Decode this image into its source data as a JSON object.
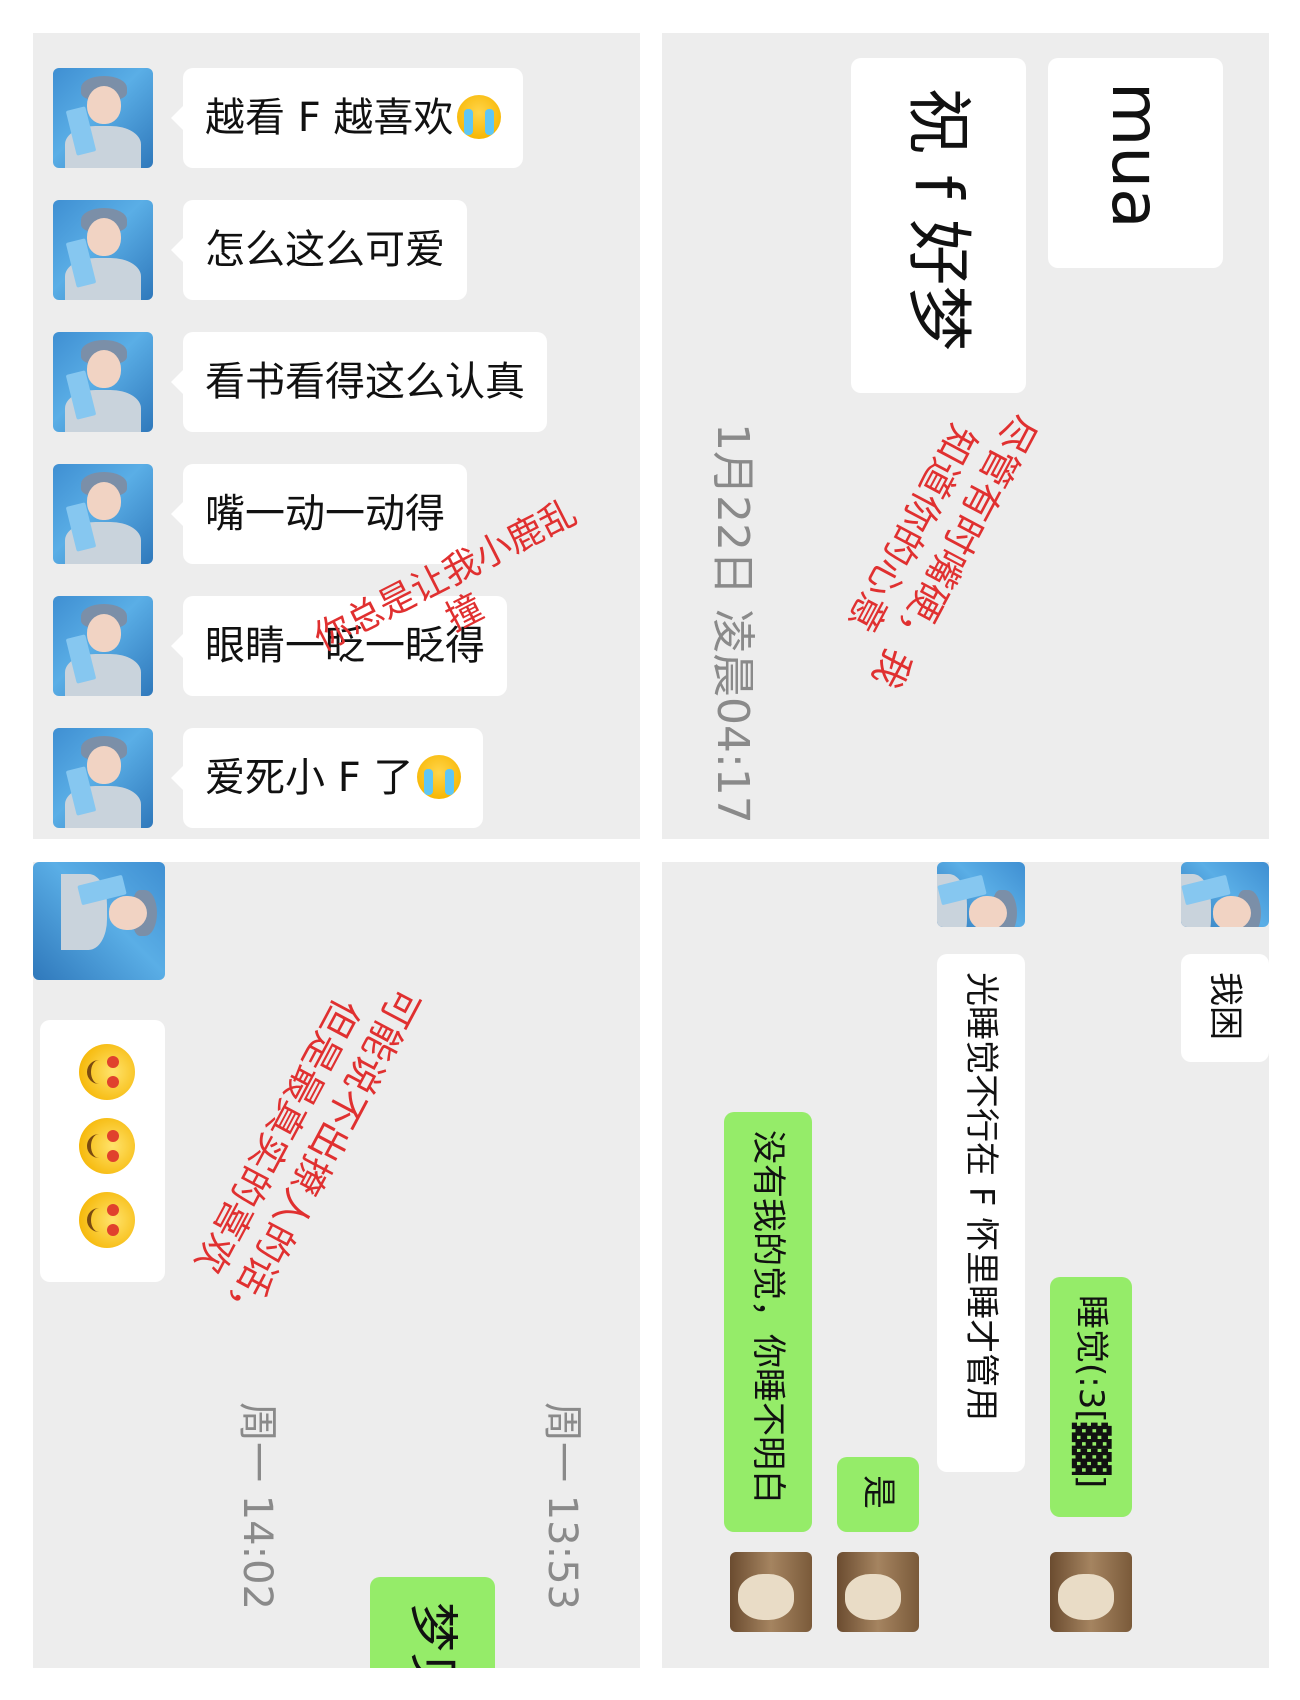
{
  "panel1": {
    "messages": [
      {
        "text": "越看 F 越喜欢",
        "emoji": "crying-face"
      },
      {
        "text": "怎么这么可爱"
      },
      {
        "text": "看书看得这么认真"
      },
      {
        "text": "嘴一动一动得"
      },
      {
        "text": "眼睛一眨一眨得"
      },
      {
        "text": "爱死小 F 了",
        "emoji": "crying-face"
      }
    ],
    "overlay_line1": "你总是让我小鹿乱",
    "overlay_line2": "撞"
  },
  "panel2": {
    "message_mua": "mua",
    "message_goodnight": "祝 f 好梦",
    "timestamp": "1月22日 凌晨04:17",
    "overlay_line1": "尽管有时嘴硬，我",
    "overlay_line2": "知道你的心意"
  },
  "panel3": {
    "emojis": [
      "heart-eyes-face",
      "heart-eyes-face",
      "heart-eyes-face"
    ],
    "timestamp_1": "周一 13:53",
    "timestamp_2": "周一 14:02",
    "message_dream": "梦见",
    "overlay_line1": "可能说不出撩人的话，",
    "overlay_line2": "但是最真实的喜欢"
  },
  "panel4": {
    "message_sleepy": "我困",
    "message_sleep_f": "光睡觉不行在 F 怀里睡才管用",
    "message_sleep_me": "睡觉(:3[▓▓]",
    "message_yes": "是",
    "message_no_sleep": "没有我的觉，你睡不明白"
  },
  "colors": {
    "chat_bg": "#ededed",
    "bubble_white": "#ffffff",
    "bubble_green": "#95ec69",
    "overlay_red": "#e03030",
    "timestamp_gray": "#8a8a8a"
  }
}
